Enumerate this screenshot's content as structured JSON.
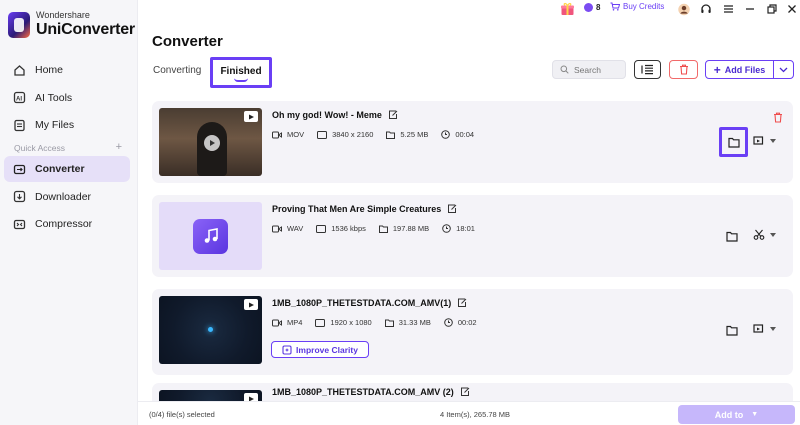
{
  "app": {
    "brand_sub": "Wondershare",
    "brand_main": "UniConverter"
  },
  "topbar": {
    "credits_count": "8",
    "buy_credits_label": "Buy Credits"
  },
  "sidebar": {
    "items": [
      {
        "label": "Home",
        "icon": "home-icon"
      },
      {
        "label": "AI Tools",
        "icon": "ai-tools-icon"
      },
      {
        "label": "My Files",
        "icon": "my-files-icon"
      }
    ],
    "quick_access_label": "Quick Access",
    "quick_items": [
      {
        "label": "Converter",
        "icon": "converter-icon",
        "active": true
      },
      {
        "label": "Downloader",
        "icon": "downloader-icon"
      },
      {
        "label": "Compressor",
        "icon": "compressor-icon"
      }
    ]
  },
  "header": {
    "title": "Converter",
    "tabs": [
      {
        "label": "Converting"
      },
      {
        "label": "Finished",
        "active": true
      }
    ],
    "search_placeholder": "Search",
    "add_files_label": "Add Files"
  },
  "files": [
    {
      "name": "Oh my god! Wow! - Meme",
      "format": "MOV",
      "resolution": "3840 x 2160",
      "size": "5.25 MB",
      "duration": "00:04"
    },
    {
      "name": "Proving That Men Are Simple Creatures",
      "format": "WAV",
      "resolution": "1536 kbps",
      "size": "197.88 MB",
      "duration": "18:01"
    },
    {
      "name": "1MB_1080P_THETESTDATA.COM_AMV(1)",
      "format": "MP4",
      "resolution": "1920 x 1080",
      "size": "31.33 MB",
      "duration": "00:02",
      "action_label": "Improve Clarity"
    },
    {
      "name": "1MB_1080P_THETESTDATA.COM_AMV (2)"
    }
  ],
  "footer": {
    "selected_text": "(0/4) file(s) selected",
    "total_text": "4 Item(s), 265.78 MB",
    "add_to_label": "Add to"
  },
  "colors": {
    "accent": "#6a3ff5",
    "active_bg": "#e6e0f8",
    "danger": "#f16a6a"
  }
}
